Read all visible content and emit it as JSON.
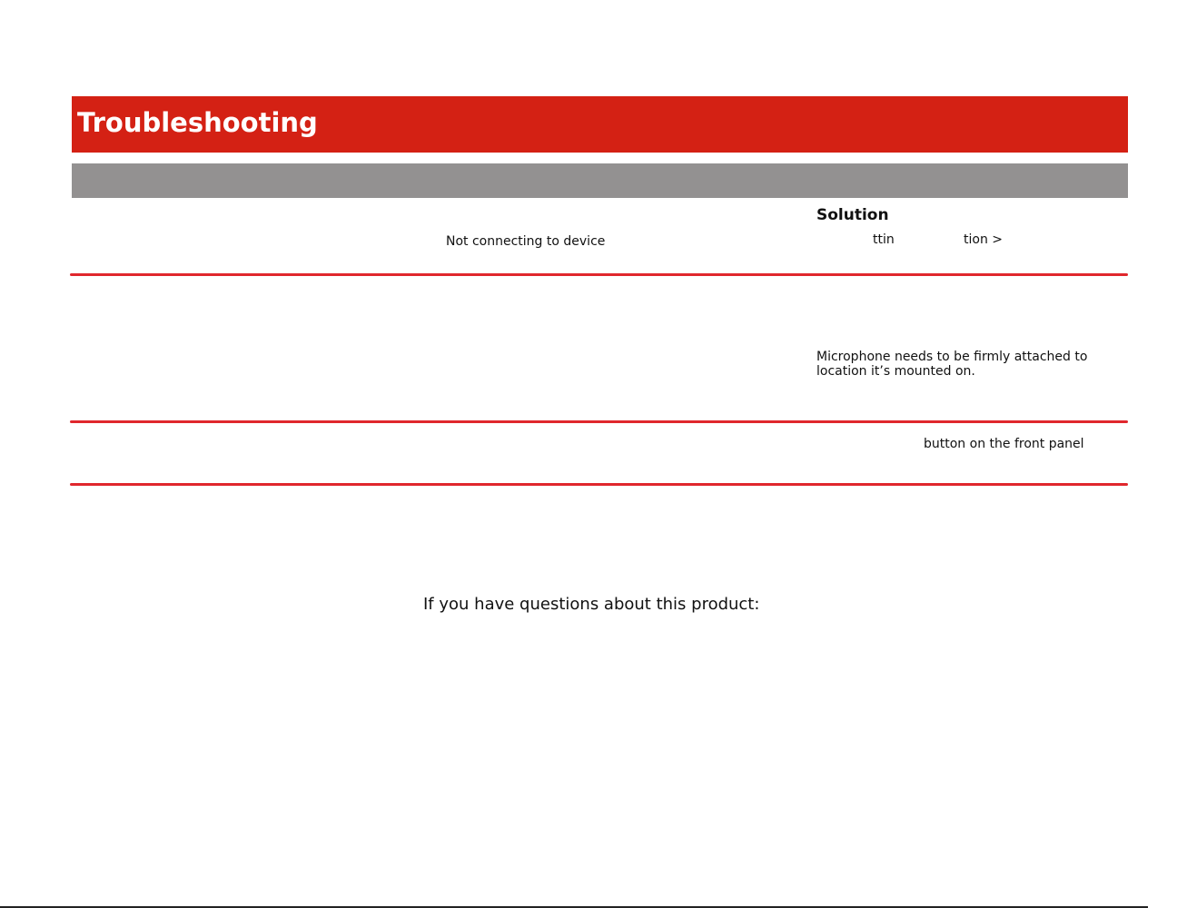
{
  "header": {
    "title": "Troubleshooting"
  },
  "table": {
    "solution_heading": "Solution",
    "rows": [
      {
        "problem": "Not connecting to device",
        "solution_fragments": [
          "ttin",
          "tion >"
        ]
      },
      {
        "problem": "",
        "solution": "Microphone needs to be firmly attached to location it’s mounted on."
      },
      {
        "problem": "",
        "solution": "button on the front panel"
      }
    ]
  },
  "footer": {
    "questions": "If you have questions about this product:"
  },
  "colors": {
    "title_bar": "#d42114",
    "header_bar": "#939191",
    "row_rule": "#e0272d"
  }
}
